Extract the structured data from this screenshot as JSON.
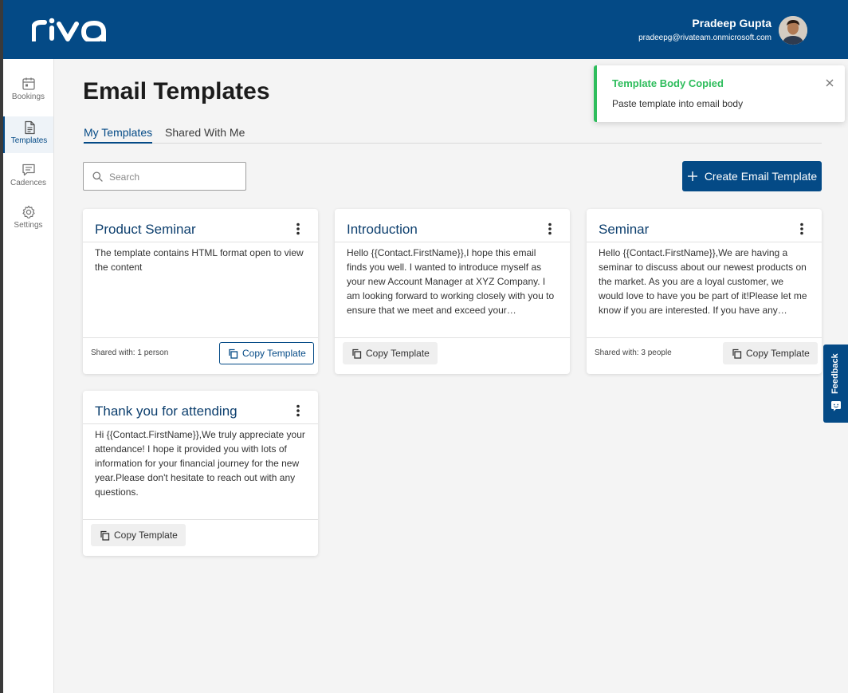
{
  "header": {
    "logo_text": "riva",
    "user_name": "Pradeep Gupta",
    "user_email": "pradeepg@rivateam.onmicrosoft.com"
  },
  "sidebar": {
    "items": [
      {
        "label": "Bookings",
        "icon": "calendar-icon"
      },
      {
        "label": "Templates",
        "icon": "document-icon",
        "active": true
      },
      {
        "label": "Cadences",
        "icon": "message-icon"
      },
      {
        "label": "Settings",
        "icon": "gear-icon"
      }
    ]
  },
  "page": {
    "title": "Email Templates",
    "tabs": [
      {
        "label": "My Templates",
        "active": true
      },
      {
        "label": "Shared With Me"
      }
    ],
    "search_placeholder": "Search",
    "create_button": "Create Email Template"
  },
  "cards": [
    {
      "title": "Product Seminar",
      "body": " The template contains HTML format open to view the content",
      "shared": "Shared with: 1 person",
      "copy_label": "Copy Template"
    },
    {
      "title": "Introduction",
      "body": " Hello {{Contact.FirstName}},I hope this email finds you well. I wanted to introduce myself as your new Account Manager at XYZ Company. I am looking forward to working closely with you to ensure that we meet and exceed your expectations.If you have any questions please let me know.",
      "shared": "",
      "copy_label": "Copy Template"
    },
    {
      "title": "Seminar",
      "body": " Hello {{Contact.FirstName}},We are having a seminar to discuss about our newest products on the market. As you are a loyal customer, we would love to have you be part of it!Please let me know if you are interested. If you have any questions, feel free to reach out.",
      "shared": "Shared with: 3 people",
      "copy_label": "Copy Template"
    },
    {
      "title": "Thank you for attending",
      "body": " Hi {{Contact.FirstName}},We truly appreciate your attendance! I hope it provided you with lots of information for your financial journey for the new year.Please don't hesitate to reach out with any questions.",
      "shared": "",
      "copy_label": "Copy Template"
    }
  ],
  "toast": {
    "title": "Template Body Copied",
    "message": "Paste template into email body"
  },
  "feedback_label": "Feedback",
  "colors": {
    "brand": "#044a86",
    "success": "#2ebd5c"
  }
}
